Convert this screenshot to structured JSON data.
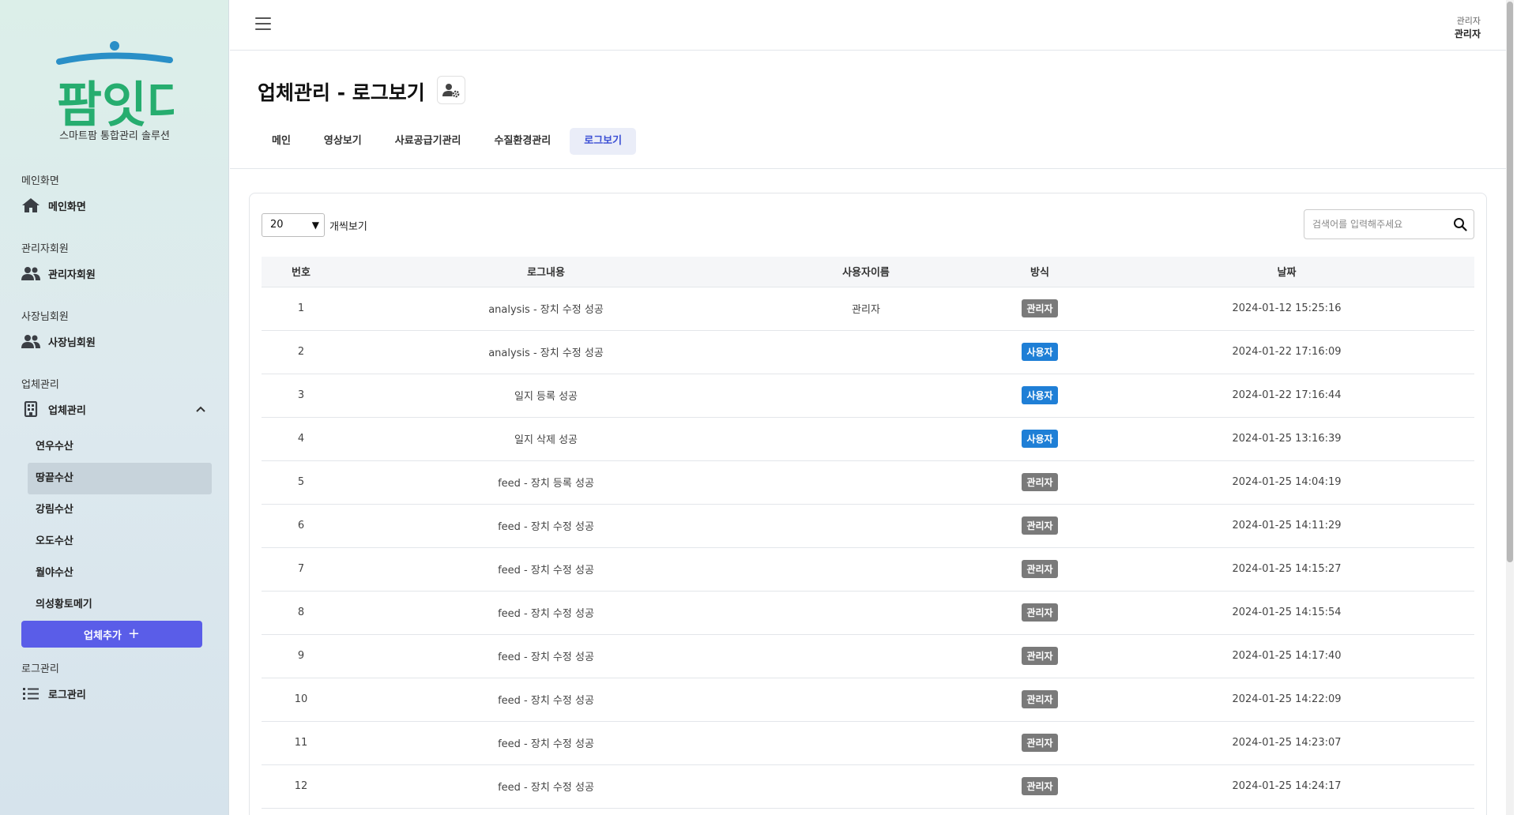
{
  "brand": {
    "logo_text": "팜잇다",
    "subtitle": "스마트팜 통합관리 솔루션",
    "colors": {
      "green": "#26ad6f",
      "blue": "#2a8fc7"
    }
  },
  "sidebar": {
    "sections": [
      {
        "title": "메인화면",
        "item": {
          "label": "메인화면",
          "icon": "home-icon"
        }
      },
      {
        "title": "관리자회원",
        "item": {
          "label": "관리자회원",
          "icon": "users-icon"
        }
      },
      {
        "title": "사장님회원",
        "item": {
          "label": "사장님회원",
          "icon": "users-icon"
        }
      },
      {
        "title": "업체관리",
        "item": {
          "label": "업체관리",
          "icon": "building-icon"
        }
      },
      {
        "title": "로그관리",
        "item": {
          "label": "로그관리",
          "icon": "list-icon"
        }
      }
    ],
    "companies": [
      "연우수산",
      "땅끝수산",
      "강림수산",
      "오도수산",
      "월야수산",
      "의성황토메기"
    ],
    "active_company": "땅끝수산",
    "add_button": "업체추가"
  },
  "header": {
    "user_role": "관리자",
    "user_name": "관리자"
  },
  "page": {
    "title": "업체관리 - 로그보기",
    "tabs": [
      "메인",
      "영상보기",
      "사료공급기관리",
      "수질환경관리",
      "로그보기"
    ],
    "active_tab": "로그보기"
  },
  "controls": {
    "per_page": "20",
    "per_page_label": "개씩보기",
    "search_placeholder": "검색어를 입력해주세요"
  },
  "table": {
    "columns": [
      "번호",
      "로그내용",
      "사용자이름",
      "방식",
      "날짜"
    ],
    "badge_colors": {
      "관리자": "#7a7a7a",
      "사용자": "#1f7fd6"
    },
    "rows": [
      {
        "no": "1",
        "content": "analysis - 장치 수정 성공",
        "user": "관리자",
        "method": "관리자",
        "date": "2024-01-12 15:25:16"
      },
      {
        "no": "2",
        "content": "analysis - 장치 수정 성공",
        "user": "",
        "method": "사용자",
        "date": "2024-01-22 17:16:09"
      },
      {
        "no": "3",
        "content": "일지 등록 성공",
        "user": "",
        "method": "사용자",
        "date": "2024-01-22 17:16:44"
      },
      {
        "no": "4",
        "content": "일지 삭제 성공",
        "user": "",
        "method": "사용자",
        "date": "2024-01-25 13:16:39"
      },
      {
        "no": "5",
        "content": "feed - 장치 등록 성공",
        "user": "",
        "method": "관리자",
        "date": "2024-01-25 14:04:19"
      },
      {
        "no": "6",
        "content": "feed - 장치 수정 성공",
        "user": "",
        "method": "관리자",
        "date": "2024-01-25 14:11:29"
      },
      {
        "no": "7",
        "content": "feed - 장치 수정 성공",
        "user": "",
        "method": "관리자",
        "date": "2024-01-25 14:15:27"
      },
      {
        "no": "8",
        "content": "feed - 장치 수정 성공",
        "user": "",
        "method": "관리자",
        "date": "2024-01-25 14:15:54"
      },
      {
        "no": "9",
        "content": "feed - 장치 수정 성공",
        "user": "",
        "method": "관리자",
        "date": "2024-01-25 14:17:40"
      },
      {
        "no": "10",
        "content": "feed - 장치 수정 성공",
        "user": "",
        "method": "관리자",
        "date": "2024-01-25 14:22:09"
      },
      {
        "no": "11",
        "content": "feed - 장치 수정 성공",
        "user": "",
        "method": "관리자",
        "date": "2024-01-25 14:23:07"
      },
      {
        "no": "12",
        "content": "feed - 장치 수정 성공",
        "user": "",
        "method": "관리자",
        "date": "2024-01-25 14:24:17"
      }
    ]
  }
}
